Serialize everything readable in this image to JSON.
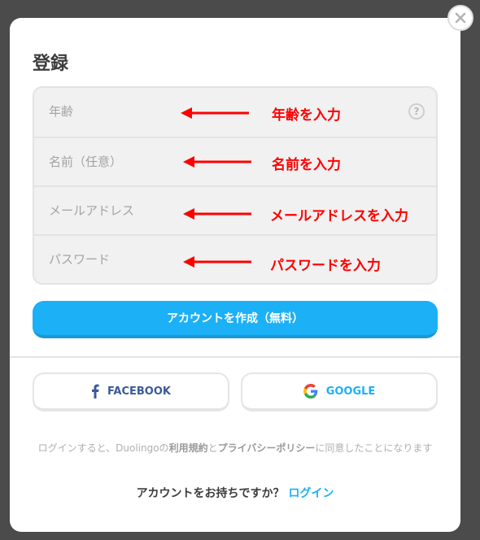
{
  "dialog": {
    "title": "登録",
    "close_icon": "close-icon"
  },
  "form": {
    "fields": [
      {
        "placeholder": "年齢",
        "annotation": "年齢を入力",
        "help": "?"
      },
      {
        "placeholder": "名前（任意）",
        "annotation": "名前を入力"
      },
      {
        "placeholder": "メールアドレス",
        "annotation": "メールアドレスを入力"
      },
      {
        "placeholder": "パスワード",
        "annotation": "パスワードを入力"
      }
    ]
  },
  "create_button": {
    "label": "アカウントを作成（無料）",
    "color": "#1cb0f6"
  },
  "social": {
    "facebook": {
      "label": "FACEBOOK",
      "icon": "facebook-icon",
      "color": "#3b5998"
    },
    "google": {
      "label": "GOOGLE",
      "icon": "google-icon",
      "color": "#1cb0f6"
    }
  },
  "terms": {
    "prefix": "ログインすると、Duolingoの",
    "terms_link": "利用規約",
    "and": "と",
    "privacy_link": "プライバシーポリシー",
    "suffix": "に同意したことになります"
  },
  "login_prompt": {
    "question": "アカウントをお持ちですか？",
    "link": "ログイン"
  },
  "annotation_color": "#ff0000"
}
